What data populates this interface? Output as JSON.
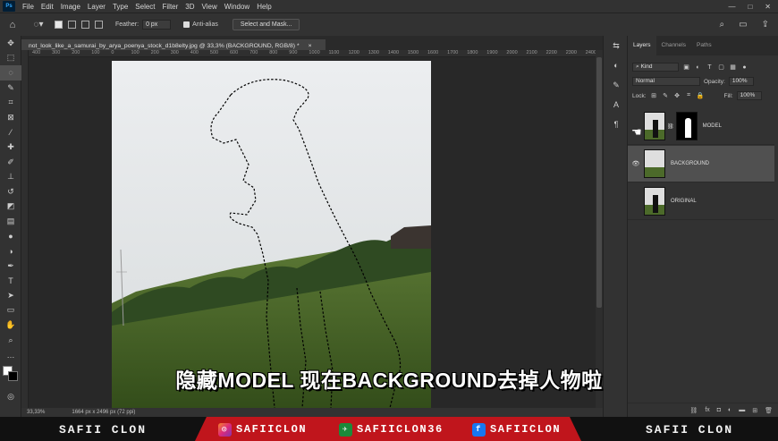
{
  "app": {
    "logo": "Ps"
  },
  "menu": [
    "File",
    "Edit",
    "Image",
    "Layer",
    "Type",
    "Select",
    "Filter",
    "3D",
    "View",
    "Window",
    "Help"
  ],
  "window_controls": [
    "—",
    "□",
    "✕"
  ],
  "options": {
    "feather_label": "Feather:",
    "feather_value": "0 px",
    "antialias_label": "Anti-alias",
    "select_mask_label": "Select and Mask..."
  },
  "document": {
    "tab_title": "not_look_like_a_samurai_by_arya_poenya_stock_d1b8elty.jpg @ 33,3% (BACKGROUND, RGB/8) *",
    "close": "×"
  },
  "ruler_ticks": [
    "400",
    "300",
    "200",
    "100",
    "0",
    "100",
    "200",
    "300",
    "400",
    "500",
    "600",
    "700",
    "800",
    "900",
    "1000",
    "1100",
    "1200",
    "1300",
    "1400",
    "1500",
    "1600",
    "1700",
    "1800",
    "1900",
    "2000",
    "2100",
    "2200",
    "2300",
    "2400"
  ],
  "status": {
    "zoom": "33,33%",
    "dims": "1664 px x 2496 px (72 ppi)"
  },
  "panel": {
    "tabs": [
      "Layers",
      "Channels",
      "Paths"
    ],
    "kind_label": "Kind",
    "blend_mode": "Normal",
    "opacity_label": "Opacity:",
    "opacity_value": "100%",
    "lock_label": "Lock:",
    "fill_label": "Fill:",
    "fill_value": "100%",
    "layers": [
      {
        "name": "MODEL",
        "visible": false,
        "has_mask": true,
        "active": false
      },
      {
        "name": "BACKGROUND",
        "visible": true,
        "has_mask": false,
        "active": true
      },
      {
        "name": "ORIGINAL",
        "visible": false,
        "has_mask": false,
        "active": false
      }
    ]
  },
  "subtitle": "隐藏MODEL 现在BACKGROUND去掉人物啦",
  "banner": {
    "left_name": "SAFII CLON",
    "instagram": "SAFIICLON",
    "app_handle": "SAFIICLON36",
    "facebook": "SAFIICLON",
    "right_name": "SAFII CLON"
  },
  "colors": {
    "accent": "#c0151c",
    "ui_dark": "#323232",
    "sky": "#e6e8ea",
    "grass": "#4c6a2a"
  }
}
